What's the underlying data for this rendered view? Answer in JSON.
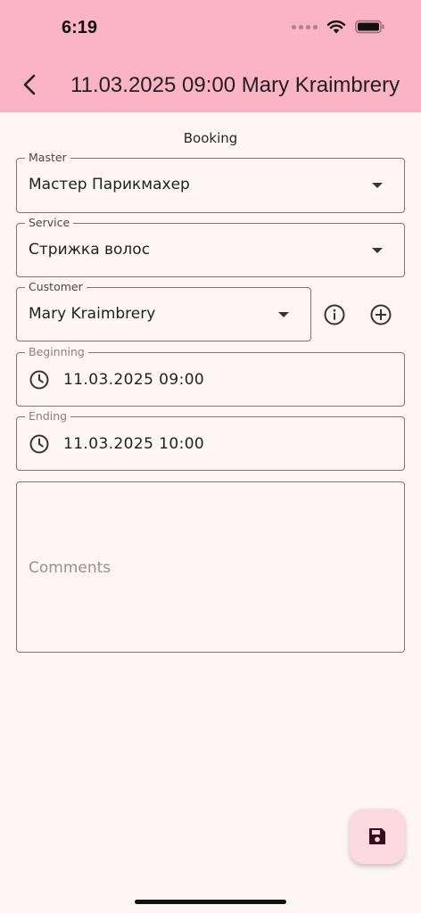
{
  "status_bar": {
    "time": "6:19"
  },
  "app_bar": {
    "title": "11.03.2025 09:00 Mary Kraimbrery"
  },
  "form": {
    "section_title": "Booking",
    "master": {
      "label": "Master",
      "value": "Мастер Парикмахер"
    },
    "service": {
      "label": "Service",
      "value": "Стрижка волос"
    },
    "customer": {
      "label": "Customer",
      "value": "Mary Kraimbrery"
    },
    "beginning": {
      "label": "Beginning",
      "value": "11.03.2025 09:00"
    },
    "ending": {
      "label": "Ending",
      "value": "11.03.2025 10:00"
    },
    "comments": {
      "placeholder": "Comments"
    }
  },
  "colors": {
    "app_bar": "#fbb4c3",
    "background": "#fdf6f5",
    "outline": "#857375",
    "fab": "#fcd9df",
    "fab_icon": "#3b0a1c"
  }
}
